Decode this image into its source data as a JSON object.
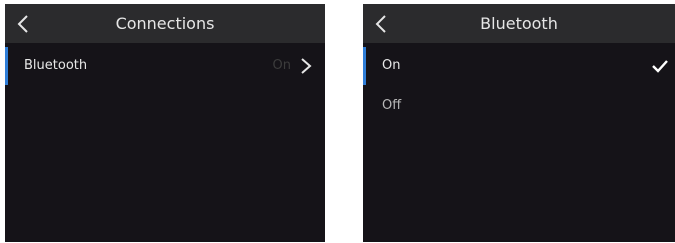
{
  "left": {
    "title": "Connections",
    "back_icon": "chevron-left-icon",
    "items": [
      {
        "label": "Bluetooth",
        "value": "On",
        "icon": "chevron-right-icon"
      }
    ]
  },
  "right": {
    "title": "Bluetooth",
    "back_icon": "chevron-left-icon",
    "options": [
      {
        "label": "On",
        "selected": true,
        "icon": "checkmark-icon"
      },
      {
        "label": "Off",
        "selected": false
      }
    ]
  },
  "colors": {
    "background": "#151318",
    "header": "#2b2b2d",
    "accent": "#2f7ed8",
    "text": "#e8e8e8"
  }
}
